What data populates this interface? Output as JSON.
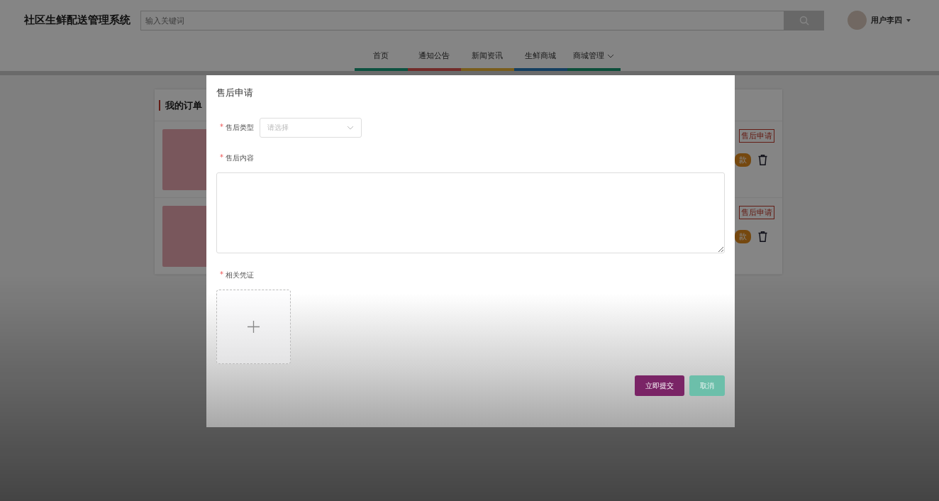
{
  "header": {
    "site_title": "社区生鲜配送管理系统",
    "search": {
      "placeholder": "输入关键词"
    },
    "user": {
      "name": "用户李四"
    }
  },
  "nav": [
    {
      "label": "首页",
      "has_menu": false
    },
    {
      "label": "通知公告",
      "has_menu": false
    },
    {
      "label": "新闻资讯",
      "has_menu": false
    },
    {
      "label": "生鲜商城",
      "has_menu": false
    },
    {
      "label": "商城管理",
      "has_menu": true
    }
  ],
  "orders": {
    "title": "我的订单",
    "rows": [
      {
        "tag": "售后申请",
        "badge": "款"
      },
      {
        "tag": "售后申请",
        "badge": "款"
      }
    ]
  },
  "dialog": {
    "title": "售后申请",
    "fields": [
      {
        "kind": "select",
        "label": "售后类型",
        "required_mark": "*",
        "placeholder": "请选择"
      },
      {
        "kind": "textarea",
        "label": "售后内容",
        "required_mark": "*"
      },
      {
        "kind": "upload",
        "label": "相关凭证",
        "required_mark": "*"
      }
    ],
    "buttons": [
      {
        "label": "立即提交",
        "kind": "primary"
      },
      {
        "label": "取消",
        "kind": "secondary"
      }
    ]
  }
}
